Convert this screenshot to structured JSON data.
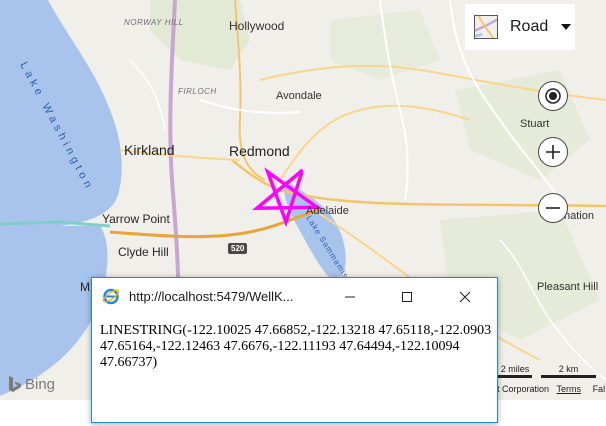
{
  "map": {
    "labels": {
      "norway_hill": "NORWAY HILL",
      "hollywood": "Hollywood",
      "firloch": "FIRLOCH",
      "avondale": "Avondale",
      "stuart": "Stuart",
      "kirkland": "Kirkland",
      "redmond": "Redmond",
      "adelaide": "Adelaide",
      "yarrow_point": "Yarrow Point",
      "clyde_hill": "Clyde Hill",
      "route_520": "520",
      "pleasant_hill": "Pleasant Hill",
      "lake_washington": "Lake Washington",
      "lake_sammamish": "Lake Sammamish",
      "nation_partial": "nation",
      "m_partial": "M"
    },
    "star_color": "#ff00ff",
    "water_color": "#a9c4ec"
  },
  "map_style_selector": {
    "label": "Road",
    "icon": "road-thumbnail-icon"
  },
  "controls": {
    "locate_icon": "locate-me-icon",
    "zoom_in_icon": "plus-icon",
    "zoom_out_icon": "minus-icon"
  },
  "branding": {
    "logo_text": "Bing"
  },
  "scale": {
    "miles": "2 miles",
    "km": "2 km"
  },
  "copyright": {
    "text": "t Corporation",
    "terms": "Terms",
    "more": "Fal"
  },
  "popup": {
    "url": "http://localhost:5479/WellK...",
    "icon": "internet-explorer-icon",
    "wkt": "LINESTRING(-122.10025 47.66852,-122.13218 47.65118,-122.0903 47.65164,-122.12463 47.6676,-122.11193 47.64494,-122.10094 47.66737)",
    "line_coordinates": [
      [
        -122.10025,
        47.66852
      ],
      [
        -122.13218,
        47.65118
      ],
      [
        -122.0903,
        47.65164
      ],
      [
        -122.12463,
        47.6676
      ],
      [
        -122.11193,
        47.64494
      ],
      [
        -122.10094,
        47.66737
      ]
    ]
  }
}
